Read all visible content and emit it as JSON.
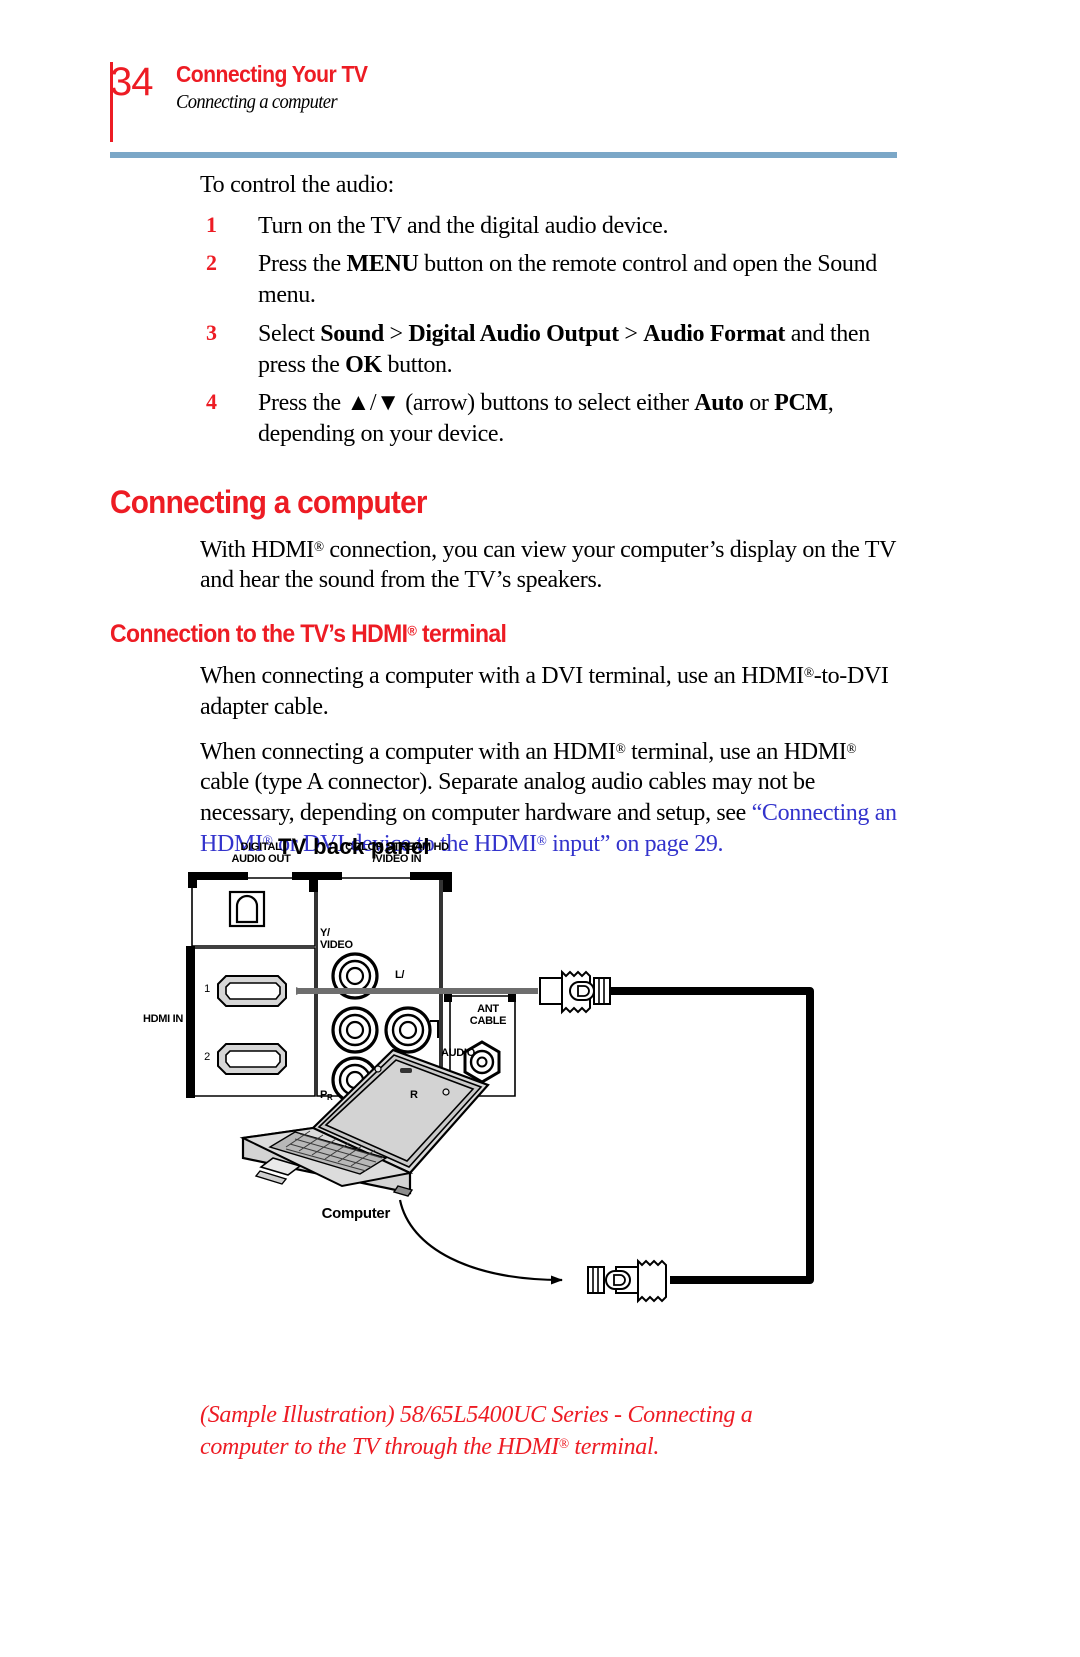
{
  "header": {
    "page_number": "34",
    "chapter": "Connecting Your TV",
    "section": "Connecting a computer"
  },
  "body": {
    "lead": "To control the audio:",
    "steps": [
      {
        "num": "1",
        "text_html": "Turn on the TV and the digital audio device."
      },
      {
        "num": "2",
        "text_html": "Press the <b>MENU</b> button on the remote control and open the Sound menu."
      },
      {
        "num": "3",
        "text_html": "Select <b>Sound</b> &gt; <b>Digital Audio Output</b> &gt; <b>Audio Format</b> and then press the <b>OK</b> button."
      },
      {
        "num": "4",
        "text_html": "Press the ▲/▼ (arrow) buttons to select either <b>Auto</b> or <b>PCM</b>, depending on your device."
      }
    ],
    "section_title": "Connecting a computer",
    "intro_para_html": "With HDMI<sup class=\"reg\">®</sup> connection, you can view your computer’s display on the TV and hear the sound from the TV’s speakers.",
    "subsection_title_html": "Connection to the TV’s HDMI<sup class=\"reg\">®</sup> terminal",
    "para_dvi_html": "When connecting a computer with a DVI terminal, use an HDMI<sup class=\"reg\">®</sup>-to-DVI adapter cable.",
    "para_hdmi_html": "When connecting a computer with an HDMI<sup class=\"reg\">®</sup> terminal, use an HDMI<sup class=\"reg\">®</sup> cable (type A connector). Separate analog audio cables may not be necessary, depending on computer hardware and setup, see <span class=\"xref\">“Connecting an HDMI<sup class=\"reg\">®</sup> or DVI device to the HDMI<sup class=\"reg\">®</sup> input” on page 29.</span>"
  },
  "figure": {
    "title": "TV back panel",
    "labels": {
      "digital_audio_out": "DIGITAL\nAUDIO OUT",
      "color_stream_hd": "COLOR STREAM HD\n/VIDEO IN",
      "y_video": "Y/\nVIDEO",
      "l_audio": "L/",
      "hdmi_in": "HDMI IN",
      "hdmi_1": "1",
      "hdmi_2": "2",
      "audio": "AUDIO",
      "pr": "P",
      "pr_sub": "R",
      "r": "R",
      "ant_cable": "ANT\nCABLE",
      "computer": "Computer"
    }
  },
  "caption": {
    "text_html": "(Sample Illustration) 58/65L5400UC Series - Connecting a computer to the TV through the HDMI<sup class=\"reg\">®</sup> terminal."
  },
  "colors": {
    "accent_red": "#ED1C24",
    "rule_blue": "#7BA7C7",
    "xref_blue": "#3333CC"
  }
}
